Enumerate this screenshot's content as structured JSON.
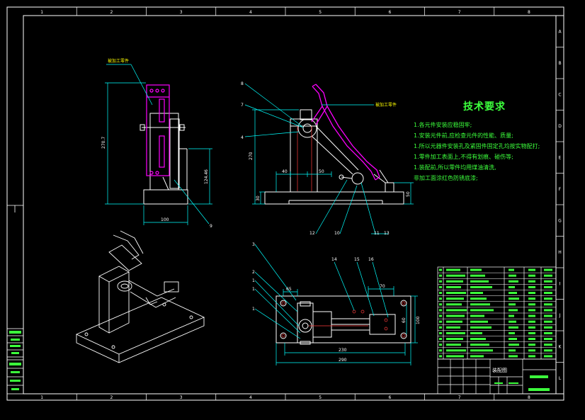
{
  "colors": {
    "background": "#000000",
    "frame": "#ffffff",
    "dimension": "#00ffff",
    "part": "#ff00ff",
    "text": "#3cff3c",
    "accent": "#ffff00",
    "hidden": "#ff3c3c"
  },
  "border": {
    "top_numbers": [
      "1",
      "2",
      "3",
      "4",
      "5",
      "6",
      "7",
      "8"
    ],
    "bottom_numbers": [
      "1",
      "2",
      "3",
      "4",
      "5",
      "6",
      "7",
      "8"
    ],
    "right_letters": [
      "A",
      "B",
      "C",
      "D",
      "E",
      "F",
      "G",
      "H",
      "I",
      "J",
      "K",
      "L"
    ]
  },
  "tech_requirements": {
    "title": "技术要求",
    "lines": [
      "1.各元件安装应稳固牢;",
      "1.安装元件前,应检查元件的性能、质量;",
      "1.所以元器件安装孔及紧固件固定孔均按实物配打;",
      "1.零件加工表面上,不得有划痕、碰伤等;",
      "1.装配前,所以零件均用煤油清洗,",
      "非加工面涂红色防锈底漆;"
    ]
  },
  "front_view": {
    "label_workpiece": "被加工零件",
    "dim_height": "270.7",
    "dim_small_height": "124.46",
    "dim_width": "100",
    "balloon": "9"
  },
  "side_view": {
    "label_workpiece": "被加工零件",
    "dim_height": "270",
    "dim_40": "40",
    "dim_50": "50",
    "dim_30": "30",
    "dim_right": "50",
    "balloons": [
      "8",
      "7",
      "4",
      "12",
      "10",
      "11",
      "13"
    ]
  },
  "top_view": {
    "dim_230": "230",
    "dim_290": "290",
    "dim_65": "65",
    "dim_70": "70",
    "dim_60": "60",
    "dim_100": "100",
    "balloons": [
      "3",
      "2",
      "1",
      "1",
      "1",
      "14",
      "15",
      "16"
    ]
  },
  "title_block": {
    "drawing_name": "装配图"
  }
}
